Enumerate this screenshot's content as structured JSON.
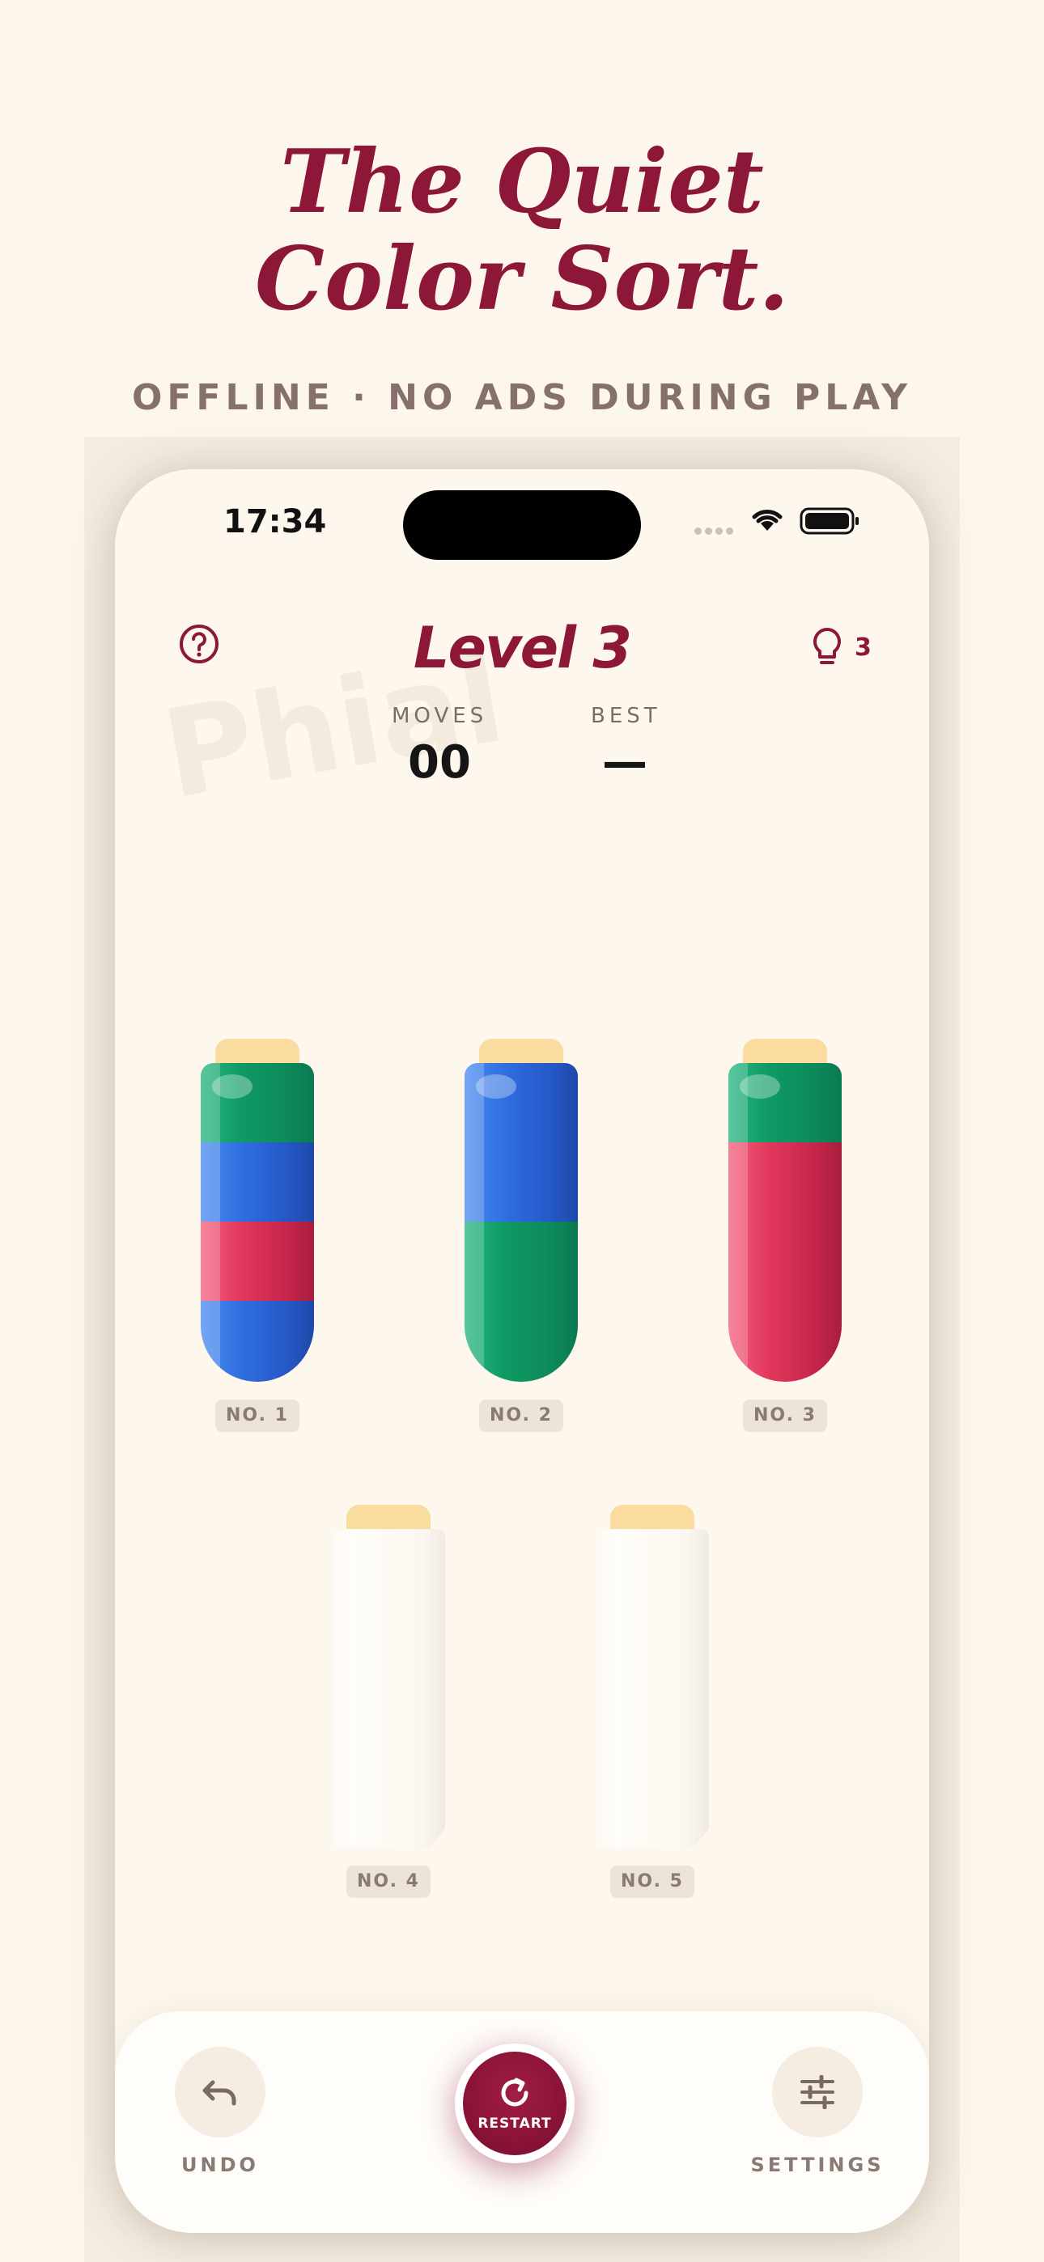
{
  "hero": {
    "headline_line1": "The Quiet",
    "headline_line2": "Color Sort.",
    "tagline": "OFFLINE · NO ADS DURING PLAY"
  },
  "status_bar": {
    "time": "17:34",
    "icons": [
      "signal-icon",
      "wifi-icon",
      "battery-icon"
    ]
  },
  "game": {
    "watermark": "Phial",
    "level_title": "Level 3",
    "hint_count": "3",
    "moves_label": "MOVES",
    "moves_value": "00",
    "best_label": "BEST",
    "best_value": "—",
    "tubes": [
      {
        "label": "NO. 1",
        "layers_top_to_bottom": [
          "green",
          "blue",
          "red",
          "blue"
        ]
      },
      {
        "label": "NO. 2",
        "layers_top_to_bottom": [
          "blue",
          "blue",
          "green",
          "green"
        ]
      },
      {
        "label": "NO. 3",
        "layers_top_to_bottom": [
          "green",
          "red",
          "red",
          "red"
        ]
      },
      {
        "label": "NO. 4",
        "layers_top_to_bottom": []
      },
      {
        "label": "NO. 5",
        "layers_top_to_bottom": []
      }
    ]
  },
  "toolbar": {
    "undo_label": "UNDO",
    "restart_label": "RESTART",
    "settings_label": "SETTINGS"
  },
  "colors": {
    "accent": "#8c1738",
    "background": "#fdf6ec",
    "green": "#0f9a65",
    "blue": "#2f6fe0",
    "red": "#e3385d",
    "cork": "#fbdca0"
  }
}
